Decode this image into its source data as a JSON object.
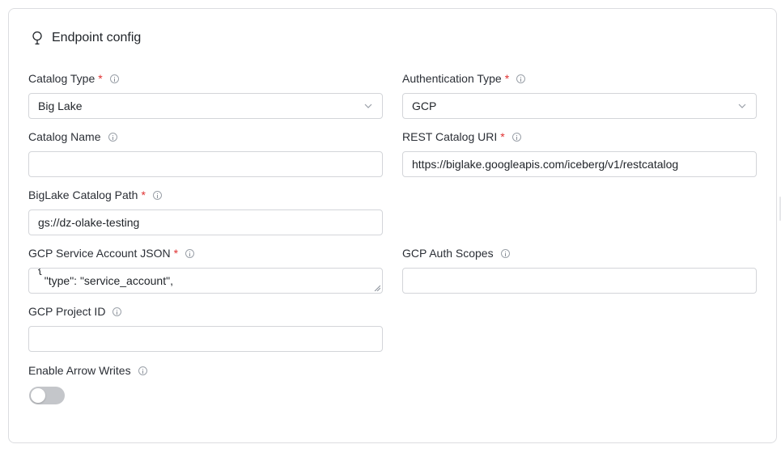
{
  "header": {
    "title": "Endpoint config",
    "icon": "lightbulb-icon"
  },
  "fields": {
    "catalog_type": {
      "label": "Catalog Type",
      "required": "*",
      "value": "Big Lake"
    },
    "auth_type": {
      "label": "Authentication Type",
      "required": "*",
      "value": "GCP"
    },
    "catalog_name": {
      "label": "Catalog Name",
      "value": ""
    },
    "rest_uri": {
      "label": "REST Catalog URI",
      "required": "*",
      "value": "https://biglake.googleapis.com/iceberg/v1/restcatalog"
    },
    "biglake_path": {
      "label": "BigLake Catalog Path",
      "required": "*",
      "value": "gs://dz-olake-testing"
    },
    "service_account": {
      "label": "GCP Service Account JSON",
      "required": "*",
      "value": "{\n  \"type\": \"service_account\","
    },
    "auth_scopes": {
      "label": "GCP Auth Scopes",
      "value": ""
    },
    "project_id": {
      "label": "GCP Project ID",
      "value": ""
    },
    "arrow_writes": {
      "label": "Enable Arrow Writes",
      "enabled": false
    }
  },
  "colors": {
    "required": "#e03131",
    "toggle_off": "#c4c6ca",
    "border": "#d3d5d9"
  }
}
